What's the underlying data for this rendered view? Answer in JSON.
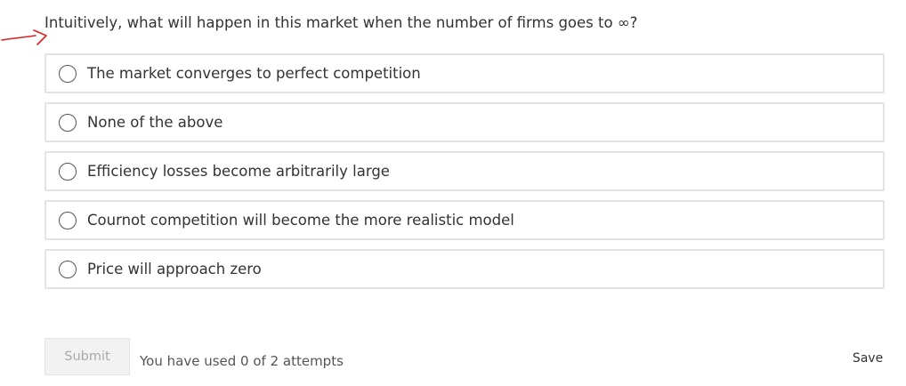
{
  "question": {
    "text": "Intuitively, what will happen in this market when the number of firms goes to ",
    "symbol": "∞",
    "end": "?"
  },
  "options": [
    {
      "label": "The market converges to perfect competition"
    },
    {
      "label": "None of the above"
    },
    {
      "label": "Efficiency losses become arbitrarily large"
    },
    {
      "label": "Cournot competition will become the more realistic model"
    },
    {
      "label": "Price will approach zero"
    }
  ],
  "footer": {
    "submit_label": "Submit",
    "attempts_text": "You have used 0 of 2 attempts",
    "save_label": "Save"
  },
  "annotation": {
    "arrow_color": "#e02020"
  }
}
